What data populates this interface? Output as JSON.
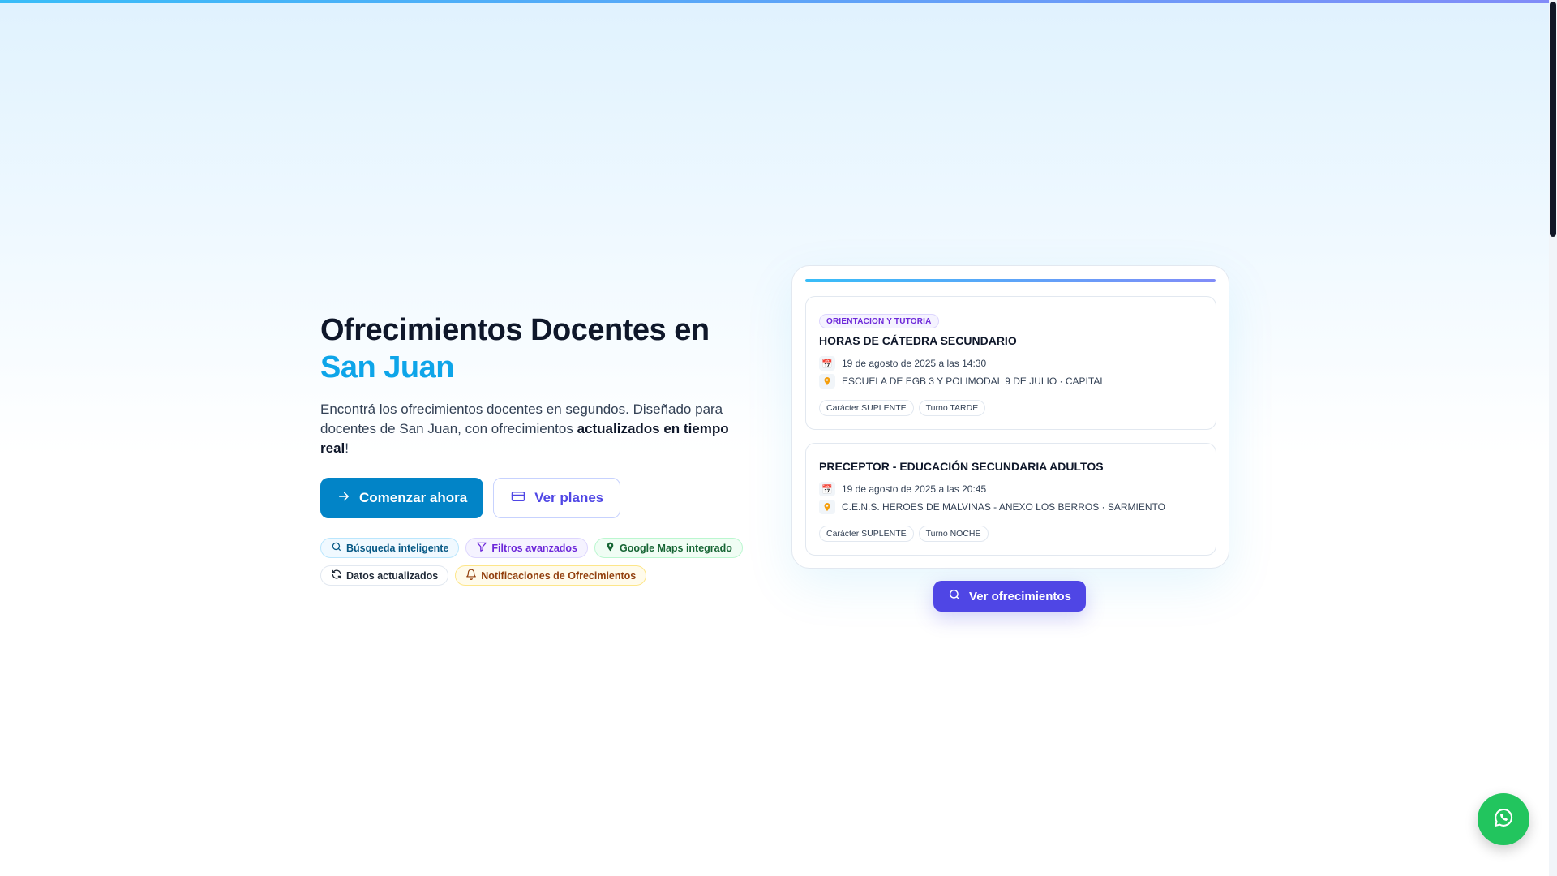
{
  "hero": {
    "title_line1": "Ofrecimientos Docentes en",
    "title_accent": "San Juan",
    "description_start": "Encontrá los ofrecimientos docentes en segundos. Diseñado para docentes de San Juan, con ofrecimientos ",
    "description_bold": "actualizados en tiempo real",
    "description_end": "!",
    "primary_cta": "Comenzar ahora",
    "secondary_cta": "Ver planes"
  },
  "features": [
    {
      "label": "Búsqueda inteligente",
      "icon": "search-icon",
      "color": "#075985"
    },
    {
      "label": "Filtros avanzados",
      "icon": "filter-icon",
      "color": "#6d28d9"
    },
    {
      "label": "Google Maps integrado",
      "icon": "map-pin-icon",
      "color": "#166534"
    },
    {
      "label": "Datos actualizados",
      "icon": "refresh-icon",
      "color": "#1f2937"
    },
    {
      "label": "Notificaciones de Ofrecimientos",
      "icon": "bell-icon",
      "color": "#92400e"
    }
  ],
  "offers": [
    {
      "badge": "ORIENTACION Y TUTORIA",
      "title": "HORAS DE CÁTEDRA SECUNDARIO",
      "date": "19 de agosto de 2025 a las 14:30",
      "location": "ESCUELA DE EGB 3 Y POLIMODAL 9 DE JULIO · CAPITAL",
      "tags": [
        "Carácter SUPLENTE",
        "Turno TARDE"
      ]
    },
    {
      "badge": "",
      "title": "PRECEPTOR - EDUCACIÓN SECUNDARIA ADULTOS",
      "date": "19 de agosto de 2025 a las 20:45",
      "location": "C.E.N.S. HEROES DE MALVINAS - ANEXO LOS BERROS · SARMIENTO",
      "tags": [
        "Carácter SUPLENTE",
        "Turno NOCHE"
      ]
    }
  ],
  "view_offers_button": "Ver ofrecimientos",
  "colors": {
    "brand": "#0284c7",
    "accent": "#0ea5e9",
    "indigo": "#4f46e5",
    "whatsapp": "#22c55e"
  }
}
